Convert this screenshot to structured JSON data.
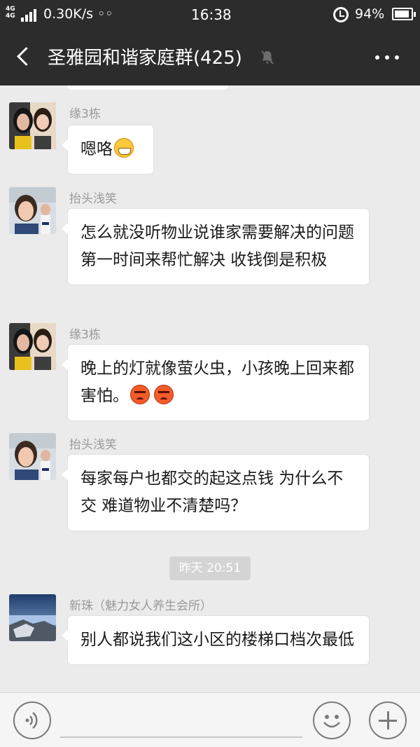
{
  "status_bar": {
    "network_top": "4G",
    "network_bottom": "4G",
    "speed": "0.30K/s ◦◦",
    "time": "16:38",
    "battery_pct": "94%"
  },
  "header": {
    "title": "圣雅园和谐家庭群(425)",
    "muted": true
  },
  "messages": [
    {
      "sender": "缘3栋",
      "avatar": "yuan3dong-avatar",
      "text": "嗯咯",
      "emojis": [
        "grin"
      ]
    },
    {
      "sender": "抬头浅笑",
      "avatar": "taitou-avatar",
      "text": "怎么就没听物业说谁家需要解决的问题 第一时间来帮忙解决 收钱倒是积极",
      "emojis": []
    },
    {
      "sender": "缘3栋",
      "avatar": "yuan3dong-avatar",
      "text": "晚上的灯就像萤火虫，小孩晚上回来都害怕。",
      "emojis": [
        "angry",
        "angry"
      ]
    },
    {
      "sender": "抬头浅笑",
      "avatar": "taitou-avatar",
      "text": "每家每户也都交的起这点钱 为什么不交 难道物业不清楚吗？",
      "emojis": []
    },
    {
      "sender": "新珠（魅力女人养生会所）",
      "avatar": "xinzhu-avatar",
      "text": "别人都说我们这小区的楼梯口档次最低",
      "emojis": []
    }
  ],
  "timestamp": "昨天 20:51",
  "input_bar": {
    "placeholder": ""
  },
  "colors": {
    "header_bg": "#2c2c2c",
    "chat_bg": "#ebebeb",
    "bubble_bg": "#ffffff",
    "sender_text": "#9a9a9a"
  }
}
